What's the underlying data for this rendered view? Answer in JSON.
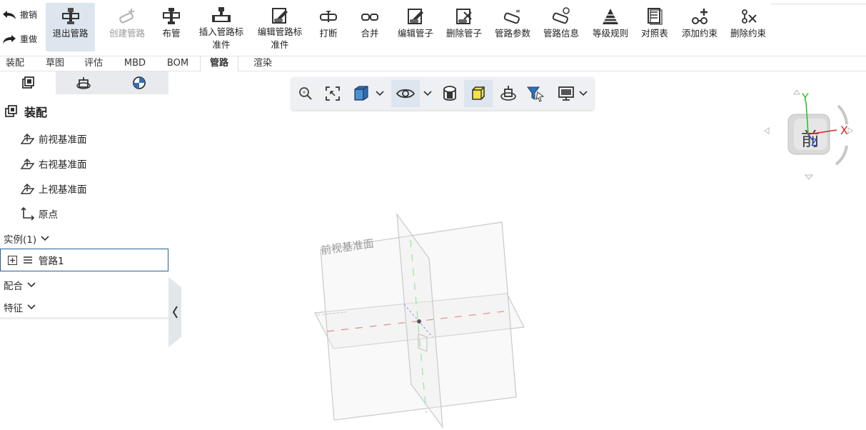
{
  "ribbon": {
    "undo": "撤销",
    "redo": "重做",
    "tools": [
      {
        "id": "exit",
        "label": "退出管路"
      },
      {
        "id": "create",
        "label": "创建管路"
      },
      {
        "id": "route",
        "label": "布管"
      },
      {
        "id": "insert",
        "label": "插入管路标\n准件"
      },
      {
        "id": "edit_std",
        "label": "编辑管路标\n准件"
      },
      {
        "id": "break",
        "label": "打断"
      },
      {
        "id": "merge",
        "label": "合并"
      },
      {
        "id": "edit_pipe",
        "label": "编辑管子"
      },
      {
        "id": "delete_pipe",
        "label": "删除管子"
      },
      {
        "id": "params",
        "label": "管路参数"
      },
      {
        "id": "info",
        "label": "管路信息"
      },
      {
        "id": "grade",
        "label": "等级规则"
      },
      {
        "id": "table",
        "label": "对照表"
      },
      {
        "id": "add_constraint",
        "label": "添加约束"
      },
      {
        "id": "del_constraint",
        "label": "删除约束"
      }
    ]
  },
  "tabs": [
    "装配",
    "草图",
    "评估",
    "MBD",
    "BOM",
    "管路",
    "渲染"
  ],
  "active_tab": "管路",
  "left_panel": {
    "root_label": "装配",
    "items": [
      "前视基准面",
      "右视基准面",
      "上视基准面",
      "原点"
    ],
    "instances_header": "实例(1)",
    "instance_item": "管路1",
    "mates_header": "配合",
    "features_header": "特征"
  },
  "viewport": {
    "plane_label": "前视基准面",
    "cube_face": "前",
    "axis_x": "X",
    "axis_y": "Y",
    "axis_z": "Z"
  },
  "colors": {
    "accent": "#2b5f93",
    "active_tool_bg": "#dde6ee",
    "axis_x": "#e02020",
    "axis_y": "#20c020",
    "axis_z": "#2040e0"
  }
}
